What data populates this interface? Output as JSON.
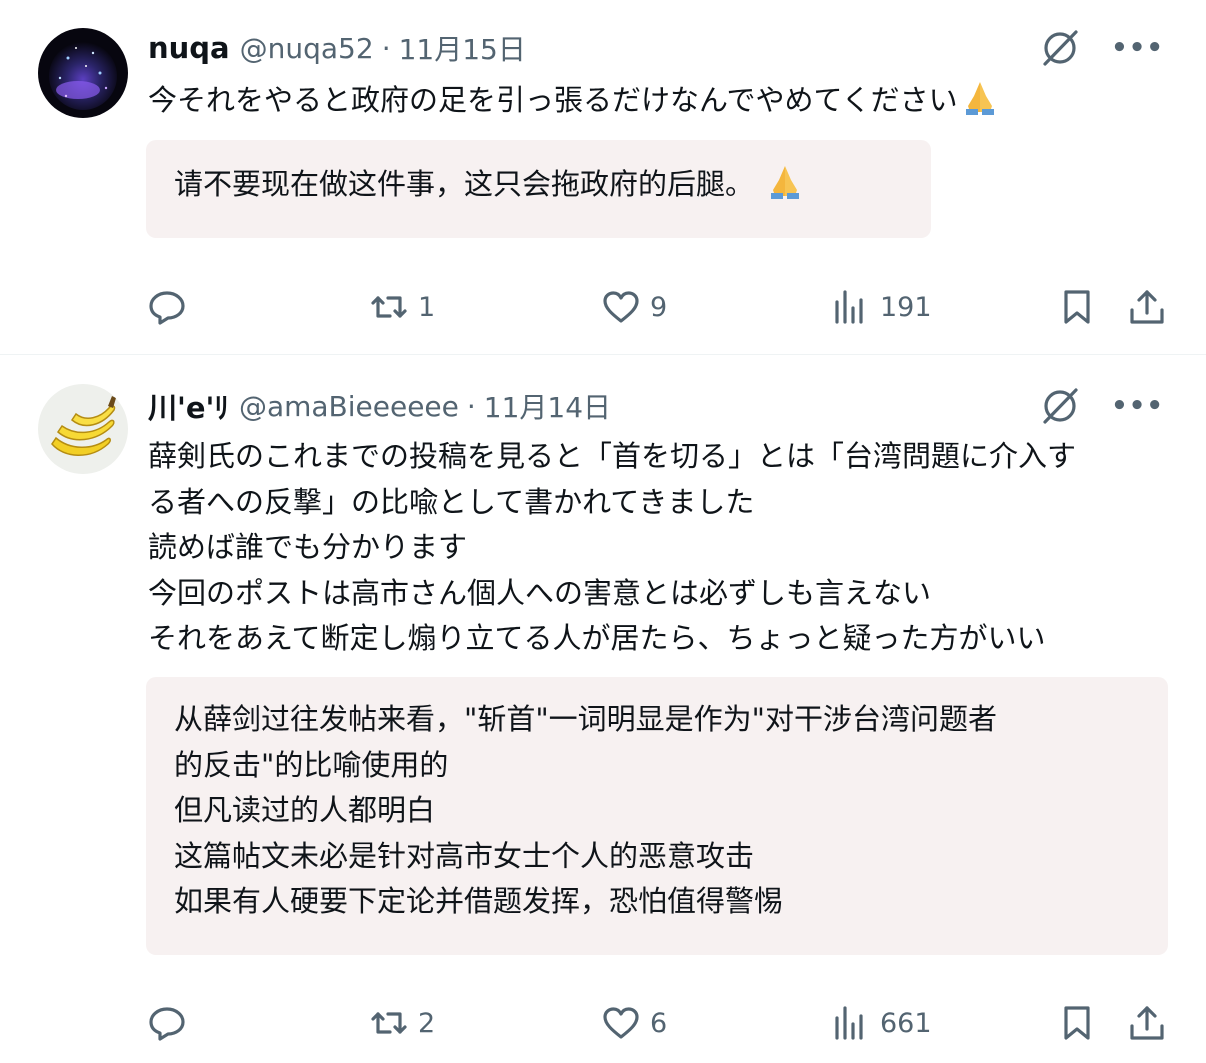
{
  "posts": [
    {
      "name": "nuqa",
      "handle": "@nuqa52",
      "sep": "·",
      "date": "11月15日",
      "avatar_icon": "galaxy-avatar",
      "text": "今それをやると政府の足を引っ張るだけなんでやめてください",
      "translation": "请不要现在做这件事，这只会拖政府的后腿。",
      "emoji": "folded-hands",
      "more": "•••",
      "reposts": "1",
      "likes": "9",
      "views": "191"
    },
    {
      "name": "川'e'ﾘ",
      "handle": "@amaBieeeeee",
      "sep": "·",
      "date": "11月14日",
      "avatar_icon": "banana-avatar",
      "text": "薛剣氏のこれまでの投稿を見ると「首を切る」とは「台湾問題に介入す\nる者への反撃」の比喩として書かれてきました\n読めば誰でも分かります\n今回のポストは高市さん個人への害意とは必ずしも言えない\nそれをあえて断定し煽り立てる人が居たら、ちょっと疑った方がいい",
      "translation": "从薛剑过往发帖来看，\"斩首\"一词明显是作为\"对干涉台湾问题者\n的反击\"的比喻使用的\n但凡读过的人都明白\n这篇帖文未必是针对高市女士个人的恶意攻击\n如果有人硬要下定论并借题发挥，恐怕值得警惕",
      "more": "•••",
      "reposts": "2",
      "likes": "6",
      "views": "661"
    }
  ],
  "colors": {
    "secondary_text": "#536471",
    "translation_bg": "#f7f1f1",
    "divider": "#eff3f4"
  }
}
